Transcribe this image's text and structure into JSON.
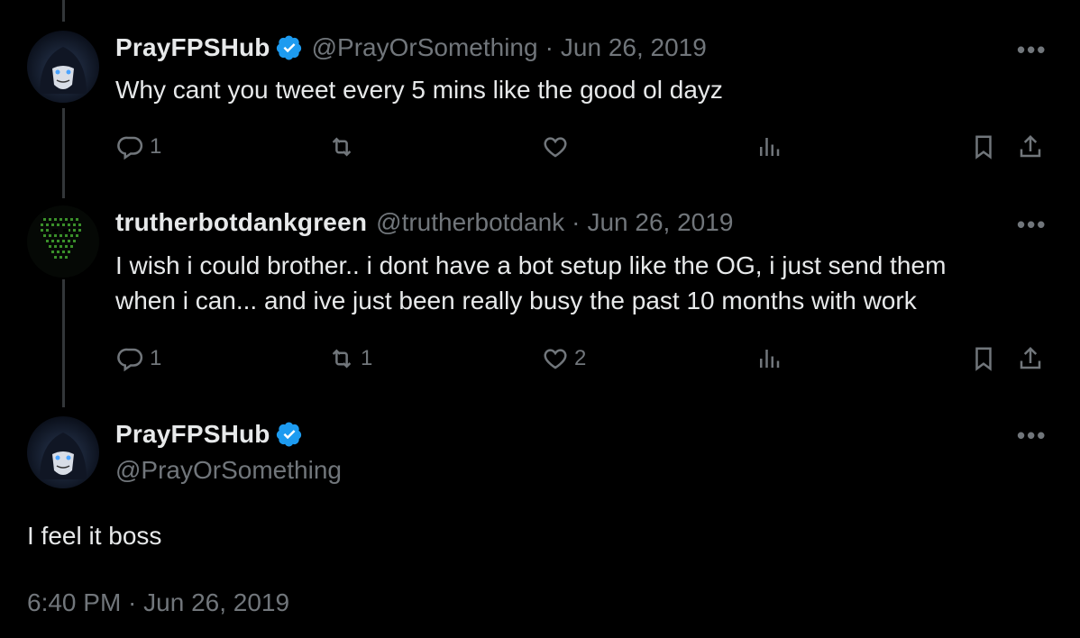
{
  "colors": {
    "background": "#000000",
    "text": "#e7e9ea",
    "muted": "#71767b",
    "verified": "#1d9bf0",
    "thread_line": "#333639"
  },
  "tweets": [
    {
      "display_name": "PrayFPSHub",
      "handle": "@PrayOrSomething",
      "separator": "·",
      "date": "Jun 26, 2019",
      "more": "•••",
      "text": "Why cant you tweet every 5 mins like the good ol dayz",
      "reply_count": "1",
      "retweet_count": "",
      "like_count": "",
      "icons": [
        "reply-icon",
        "retweet-icon",
        "like-icon",
        "views-icon",
        "bookmark-icon",
        "share-icon"
      ]
    },
    {
      "display_name": "trutherbotdankgreen",
      "handle": "@trutherbotdank",
      "separator": "·",
      "date": "Jun 26, 2019",
      "more": "•••",
      "text_line1": "I wish i could brother.. i dont have a bot setup like the OG, i just send them",
      "text_line2": "when i can... and ive just been really busy the past 10 months with work",
      "reply_count": "1",
      "retweet_count": "1",
      "like_count": "2",
      "icons": [
        "reply-icon",
        "retweet-icon",
        "like-icon",
        "views-icon",
        "bookmark-icon",
        "share-icon"
      ]
    }
  ],
  "main_tweet": {
    "display_name": "PrayFPSHub",
    "handle": "@PrayOrSomething",
    "more": "•••",
    "text": "I feel it boss",
    "timestamp": "6:40 PM · Jun 26, 2019"
  }
}
